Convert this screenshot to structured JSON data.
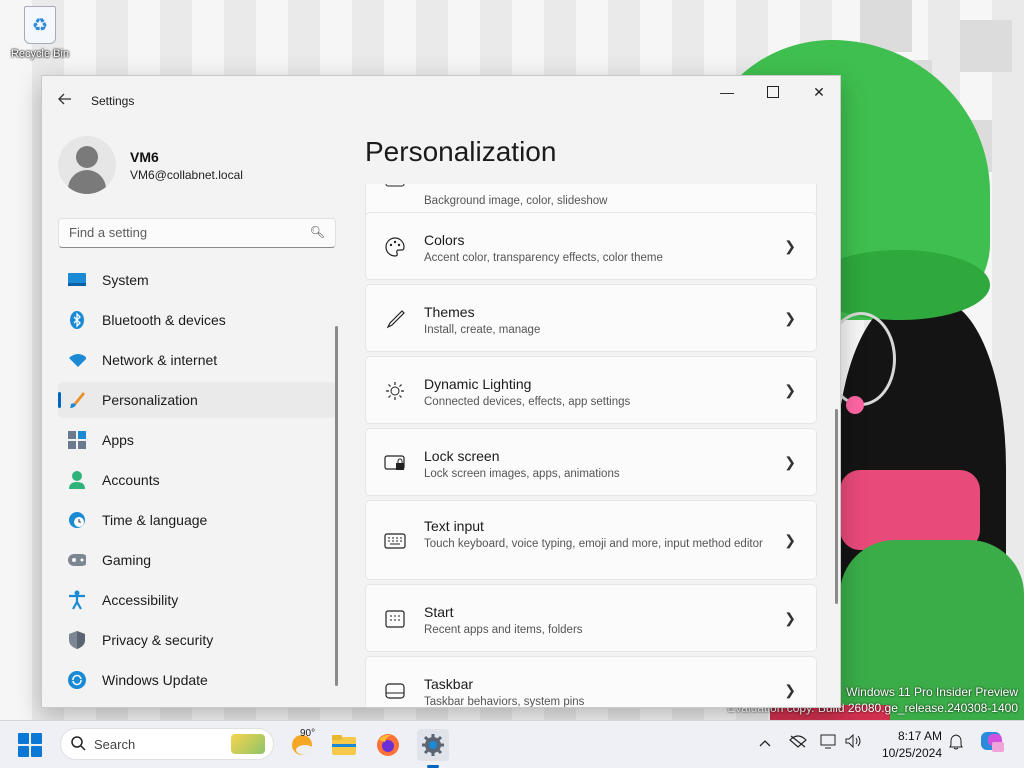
{
  "desktop": {
    "recycle_bin_label": "Recycle Bin",
    "watermark_line1": "Windows 11 Pro Insider Preview",
    "watermark_line2": "Evaluation copy. Build 26080.ge_release.240308-1400"
  },
  "window": {
    "title": "Settings",
    "controls": {
      "minimize": "—",
      "close": "✕"
    }
  },
  "profile": {
    "name": "VM6",
    "email": "VM6@collabnet.local"
  },
  "search": {
    "placeholder": "Find a setting"
  },
  "nav": {
    "items": [
      {
        "label": "System",
        "icon": "system-icon"
      },
      {
        "label": "Bluetooth & devices",
        "icon": "bluetooth-icon"
      },
      {
        "label": "Network & internet",
        "icon": "wifi-icon"
      },
      {
        "label": "Personalization",
        "icon": "brush-icon",
        "active": true
      },
      {
        "label": "Apps",
        "icon": "apps-icon"
      },
      {
        "label": "Accounts",
        "icon": "person-icon"
      },
      {
        "label": "Time & language",
        "icon": "clock-globe-icon"
      },
      {
        "label": "Gaming",
        "icon": "gamepad-icon"
      },
      {
        "label": "Accessibility",
        "icon": "accessibility-icon"
      },
      {
        "label": "Privacy & security",
        "icon": "shield-icon"
      },
      {
        "label": "Windows Update",
        "icon": "update-icon"
      }
    ]
  },
  "page": {
    "title": "Personalization",
    "cards": [
      {
        "title": "",
        "desc": "Background image, color, slideshow",
        "icon": "background-icon"
      },
      {
        "title": "Colors",
        "desc": "Accent color, transparency effects, color theme",
        "icon": "palette-icon"
      },
      {
        "title": "Themes",
        "desc": "Install, create, manage",
        "icon": "pen-icon"
      },
      {
        "title": "Dynamic Lighting",
        "desc": "Connected devices, effects, app settings",
        "icon": "lighting-icon"
      },
      {
        "title": "Lock screen",
        "desc": "Lock screen images, apps, animations",
        "icon": "lock-screen-icon"
      },
      {
        "title": "Text input",
        "desc": "Touch keyboard, voice typing, emoji and more, input method editor",
        "icon": "keyboard-icon"
      },
      {
        "title": "Start",
        "desc": "Recent apps and items, folders",
        "icon": "start-icon"
      },
      {
        "title": "Taskbar",
        "desc": "Taskbar behaviors, system pins",
        "icon": "taskbar-icon"
      }
    ]
  },
  "taskbar": {
    "search_label": "Search",
    "weather_temp": "90°",
    "time": "8:17 AM",
    "date": "10/25/2024"
  },
  "colors": {
    "accent": "#0067c0",
    "window_bg": "#f3f3f3",
    "card_bg": "#fbfbfb"
  }
}
